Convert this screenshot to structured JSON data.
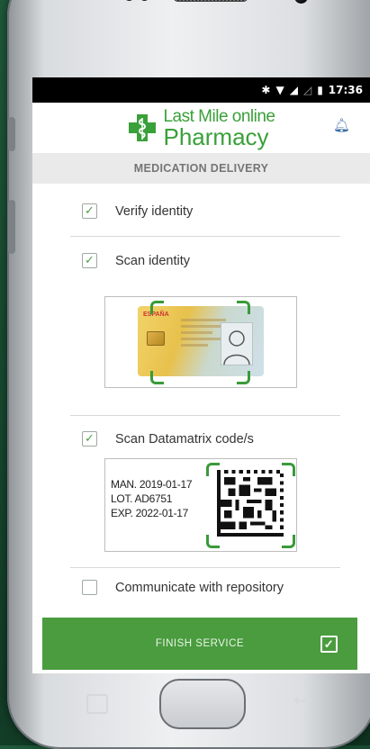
{
  "statusbar": {
    "time": "17:36"
  },
  "header": {
    "logo_line1": "Last Mile online",
    "logo_line2": "Pharmacy",
    "bell_icon": "bell-icon"
  },
  "subheader": {
    "title": "MEDICATION DELIVERY"
  },
  "checklist": [
    {
      "label": "Verify identity",
      "checked": true
    },
    {
      "label": "Scan identity",
      "checked": true
    },
    {
      "label": "Scan Datamatrix code/s",
      "checked": true
    },
    {
      "label": "Communicate with repository",
      "checked": false
    }
  ],
  "id_card": {
    "country": "ESPAÑA"
  },
  "datamatrix": {
    "man": "MAN. 2019-01-17",
    "lot": "LOT. AD6751",
    "exp": "EXP. 2022-01-17"
  },
  "finish": {
    "label": "FINISH SERVICE"
  },
  "colors": {
    "accent_green": "#4a9c3f",
    "logo_green": "#3aa03a",
    "bell_blue": "#3a6ea5"
  }
}
